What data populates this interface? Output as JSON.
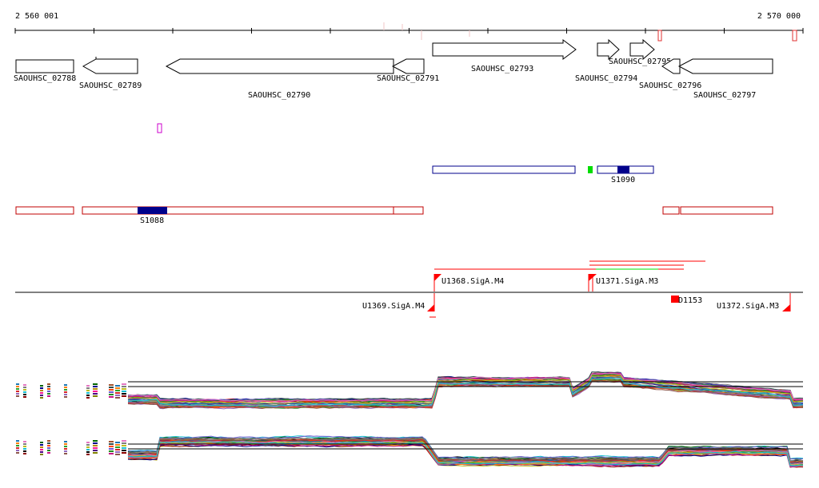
{
  "coordinates": {
    "start": "2 560 001",
    "end": "2 570 000"
  },
  "genes": [
    {
      "label": "SAOUHSC_02788",
      "dir": "none"
    },
    {
      "label": "SAOUHSC_02789",
      "dir": "left"
    },
    {
      "label": "SAOUHSC_02790",
      "dir": "left"
    },
    {
      "label": "SAOUHSC_02791",
      "dir": "left"
    },
    {
      "label": "SAOUHSC_02793",
      "dir": "right"
    },
    {
      "label": "SAOUHSC_02794",
      "dir": "right"
    },
    {
      "label": "SAOUHSC_02795",
      "dir": "right"
    },
    {
      "label": "SAOUHSC_02796",
      "dir": "left"
    },
    {
      "label": "SAOUHSC_02797",
      "dir": "left"
    }
  ],
  "segments": {
    "plus": [
      {
        "label": "S1090"
      }
    ],
    "minus": [
      {
        "label": "S1088"
      }
    ]
  },
  "promoters": [
    {
      "label": "U1368.SigA.M4",
      "strand": "plus"
    },
    {
      "label": "U1371.SigA.M3",
      "strand": "plus"
    },
    {
      "label": "U1369.SigA.M4",
      "strand": "minus"
    },
    {
      "label": "D1153",
      "strand": "minus"
    },
    {
      "label": "U1372.SigA.M3",
      "strand": "minus"
    }
  ],
  "colors": {
    "gene_outline": "#000000",
    "plus_segment": "#00008b",
    "minus_segment": "#c00000",
    "promoter": "#ff0000",
    "highlight_green": "#00dd00",
    "motif_magenta": "#cc00cc"
  }
}
